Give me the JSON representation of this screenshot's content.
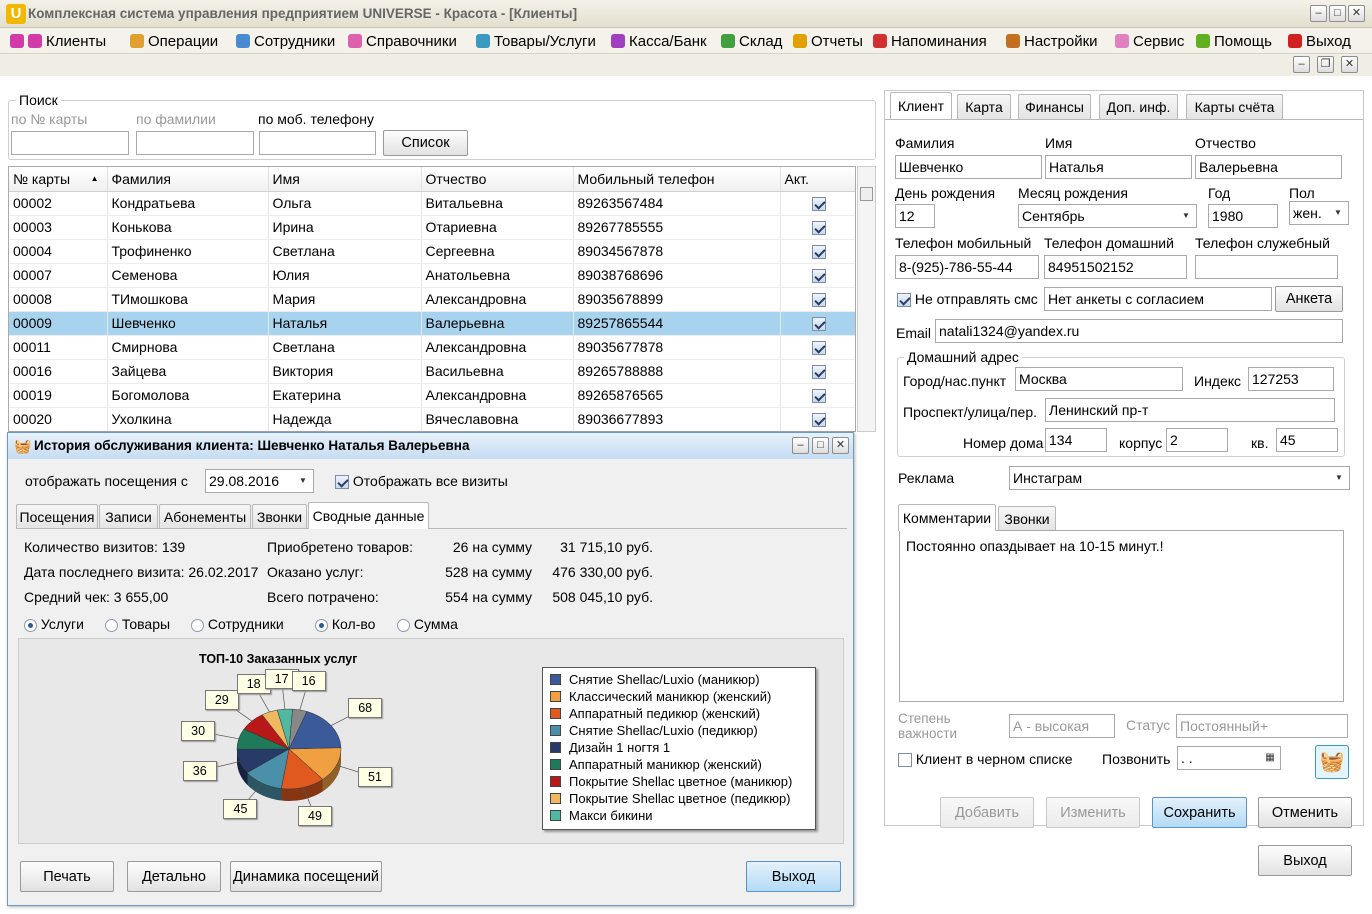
{
  "app": {
    "logo": "U",
    "title": "Комплексная система управления предприятием UNIVERSE - Красота - [Клиенты]"
  },
  "menu": [
    {
      "label": "Клиенты",
      "icon": "clients-icon",
      "color": "#d23aa8"
    },
    {
      "label": "Операции",
      "icon": "operations-icon",
      "color": "#e0a030"
    },
    {
      "label": "Сотрудники",
      "icon": "employees-icon",
      "color": "#4a8ad0"
    },
    {
      "label": "Справочники",
      "icon": "catalogs-icon",
      "color": "#e060b0"
    },
    {
      "label": "Товары/Услуги",
      "icon": "goods-icon",
      "color": "#3a9ac0"
    },
    {
      "label": "Касса/Банк",
      "icon": "cash-icon",
      "color": "#a040c0"
    },
    {
      "label": "Склад",
      "icon": "warehouse-icon",
      "color": "#40a040"
    },
    {
      "label": "Отчеты",
      "icon": "reports-icon",
      "color": "#e0a000"
    },
    {
      "label": "Напоминания",
      "icon": "reminders-icon",
      "color": "#d03030"
    },
    {
      "label": "Настройки",
      "icon": "settings-icon",
      "color": "#c07020"
    },
    {
      "label": "Сервис",
      "icon": "service-icon",
      "color": "#e080c0"
    },
    {
      "label": "Помощь",
      "icon": "help-icon",
      "color": "#60b020"
    },
    {
      "label": "Выход",
      "icon": "exit-icon",
      "color": "#d02020"
    }
  ],
  "search": {
    "group": "Поиск",
    "by_card": "по № карты",
    "by_surname": "по фамилии",
    "by_phone": "по моб. телефону",
    "list_button": "Список"
  },
  "clients_table": {
    "columns": [
      "№ карты",
      "Фамилия",
      "Имя",
      "Отчество",
      "Мобильный телефон",
      "Акт."
    ],
    "rows": [
      [
        "00002",
        "Кондратьева",
        "Ольга",
        "Витальевна",
        "89263567484"
      ],
      [
        "00003",
        "Конькова",
        "Ирина",
        "Отариевна",
        "89267785555"
      ],
      [
        "00004",
        "Трофиненко",
        "Светлана",
        "Сергеевна",
        "89034567878"
      ],
      [
        "00007",
        "Семенова",
        "Юлия",
        "Анатольевна",
        "89038768696"
      ],
      [
        "00008",
        "ТИмошкова",
        "Мария",
        "Александровна",
        "89035678899"
      ],
      [
        "00009",
        "Шевченко",
        "Наталья",
        "Валерьевна",
        "89257865544"
      ],
      [
        "00011",
        "Смирнова",
        "Светлана",
        "Александровна",
        "89035677878"
      ],
      [
        "00016",
        "Зайцева",
        "Виктория",
        "Васильевна",
        "89265788888"
      ],
      [
        "00019",
        "Богомолова",
        "Екатерина",
        "Александровна",
        "89265876565"
      ],
      [
        "00020",
        "Ухолкина",
        "Надежда",
        "Вячеславовна",
        "89036677893"
      ]
    ],
    "selected_index": 5
  },
  "history": {
    "title": "История обслуживания клиента: Шевченко Наталья Валерьевна",
    "show_from_label": "отображать посещения с",
    "show_from_date": "29.08.2016",
    "show_all_label": "Отображать все визиты",
    "tabs": [
      "Посещения",
      "Записи",
      "Абонементы",
      "Звонки",
      "Сводные данные"
    ],
    "stats": {
      "visits": "Количество визитов: 139",
      "last_visit": "Дата последнего визита: 26.02.2017",
      "avg_check": "Средний чек: 3 655,00",
      "goods_label": "Приобретено товаров:",
      "goods_count": "26 на сумму",
      "goods_sum": "31 715,10 руб.",
      "services_label": "Оказано услуг:",
      "services_count": "528 на сумму",
      "services_sum": "476 330,00 руб.",
      "total_label": "Всего потрачено:",
      "total_count": "554 на сумму",
      "total_sum": "508 045,10 руб."
    },
    "radios": {
      "services": "Услуги",
      "goods": "Товары",
      "employees": "Сотрудники",
      "count": "Кол-во",
      "sum": "Сумма"
    },
    "buttons": {
      "print": "Печать",
      "details": "Детально",
      "dynamics": "Динамика посещений",
      "exit": "Выход"
    }
  },
  "chart_data": {
    "type": "pie",
    "title": "ТОП-10 Заказанных услуг",
    "categories": [
      "Снятие Shellac/Luxio (маникюр)",
      "Классический маникюр (женский)",
      "Аппаратный педикюр (женский)",
      "Снятие Shellac/Luxio (педикюр)",
      "Дизайн 1 ногтя 1",
      "Аппаратный маникюр (женский)",
      "Покрытие Shellac  цветное (маникюр)",
      "Покрытие Shellac цветное (педикюр)",
      "Макси бикини"
    ],
    "values": [
      68,
      51,
      49,
      45,
      36,
      30,
      29,
      18,
      17,
      16
    ],
    "colors": [
      "#3a5a9a",
      "#f0a040",
      "#e05a20",
      "#4a90a8",
      "#283a68",
      "#1e7a5a",
      "#b81818",
      "#f0b860",
      "#50b8a0",
      "#888888"
    ],
    "legend": "right"
  },
  "client": {
    "tabs": [
      "Клиент",
      "Карта",
      "Финансы",
      "Доп. инф.",
      "Карты счёта"
    ],
    "surname_label": "Фамилия",
    "surname": "Шевченко",
    "name_label": "Имя",
    "name": "Наталья",
    "patronymic_label": "Отчество",
    "patronymic": "Валерьевна",
    "bday_label": "День рождения",
    "bday": "12",
    "bmonth_label": "Месяц рождения",
    "bmonth": "Сентябрь",
    "year_label": "Год",
    "year": "1980",
    "sex_label": "Пол",
    "sex": "жен.",
    "mobile_label": "Телефон мобильный",
    "mobile": "8-(925)-786-55-44",
    "home_label": "Телефон домашний",
    "home": "84951502152",
    "work_label": "Телефон служебный",
    "work": "",
    "nosms_label": "Не отправлять смс",
    "consent": "Нет анкеты с согласием",
    "survey_button": "Анкета",
    "email_label": "Email",
    "email": "natali1324@yandex.ru",
    "address_group": "Домашний адрес",
    "city_label": "Город/нас.пункт",
    "city": "Москва",
    "index_label": "Индекс",
    "index": "127253",
    "street_label": "Проспект/улица/пер.",
    "street": "Ленинский пр-т",
    "house_label": "Номер дома",
    "house": "134",
    "building_label": "корпус",
    "building": "2",
    "flat_label": "кв.",
    "flat": "45",
    "ad_label": "Реклама",
    "ad": "Инстаграм",
    "comment_tabs": [
      "Комментарии",
      "Звонки"
    ],
    "comment": "Постоянно опаздывает на 10-15 минут.!",
    "importance_label": "Степень важности",
    "importance": "А - высокая",
    "status_label": "Статус",
    "status": "Постоянный+",
    "blacklist_label": "Клиент в черном списке",
    "call_label": "Позвонить",
    "call_value": ". .",
    "buttons": {
      "add": "Добавить",
      "edit": "Изменить",
      "save": "Сохранить",
      "cancel": "Отменить",
      "exit": "Выход"
    }
  }
}
